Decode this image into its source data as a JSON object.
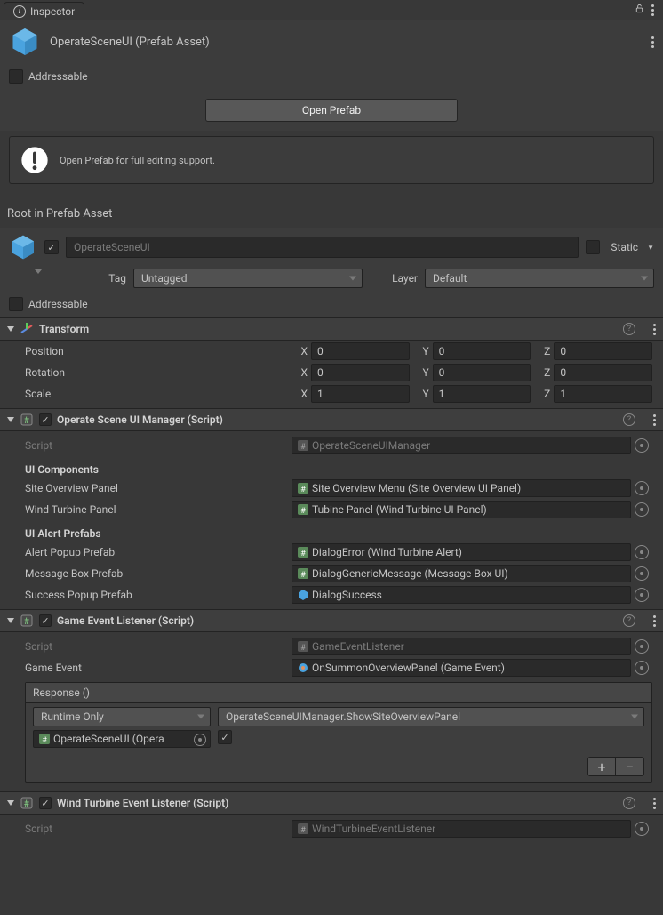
{
  "tab": {
    "title": "Inspector"
  },
  "asset": {
    "name": "OperateSceneUI (Prefab Asset)"
  },
  "addressable_label": "Addressable",
  "open_prefab_button": "Open Prefab",
  "info_message": "Open Prefab for full editing support.",
  "root_label": "Root in Prefab Asset",
  "gameobject": {
    "name": "OperateSceneUI",
    "static_label": "Static",
    "tag_label": "Tag",
    "tag_value": "Untagged",
    "layer_label": "Layer",
    "layer_value": "Default",
    "addressable_label": "Addressable"
  },
  "transform": {
    "title": "Transform",
    "rows": {
      "position": {
        "label": "Position",
        "x": "0",
        "y": "0",
        "z": "0"
      },
      "rotation": {
        "label": "Rotation",
        "x": "0",
        "y": "0",
        "z": "0"
      },
      "scale": {
        "label": "Scale",
        "x": "1",
        "y": "1",
        "z": "1"
      }
    },
    "axes": {
      "x": "X",
      "y": "Y",
      "z": "Z"
    }
  },
  "comp1": {
    "title": "Operate Scene UI Manager (Script)",
    "script_label": "Script",
    "script_value": "OperateSceneUIManager",
    "section_uicomponents": "UI Components",
    "site_overview_label": "Site Overview Panel",
    "site_overview_value": "Site Overview Menu (Site Overview UI Panel)",
    "wind_turbine_label": "Wind Turbine Panel",
    "wind_turbine_value": "Tubine Panel (Wind Turbine UI Panel)",
    "section_uialert": "UI Alert Prefabs",
    "alert_popup_label": "Alert Popup Prefab",
    "alert_popup_value": "DialogError (Wind Turbine Alert)",
    "message_box_label": "Message Box Prefab",
    "message_box_value": "DialogGenericMessage (Message Box UI)",
    "success_popup_label": "Success Popup Prefab",
    "success_popup_value": "DialogSuccess"
  },
  "comp2": {
    "title": "Game Event Listener (Script)",
    "script_label": "Script",
    "script_value": "GameEventListener",
    "game_event_label": "Game Event",
    "game_event_value": "OnSummonOverviewPanel (Game Event)",
    "response_title": "Response ()",
    "runtime_only": "Runtime Only",
    "method": "OperateSceneUIManager.ShowSiteOverviewPanel",
    "target": "OperateSceneUI (Opera"
  },
  "comp3": {
    "title": "Wind Turbine Event Listener (Script)",
    "script_label": "Script",
    "script_value": "WindTurbineEventListener"
  }
}
